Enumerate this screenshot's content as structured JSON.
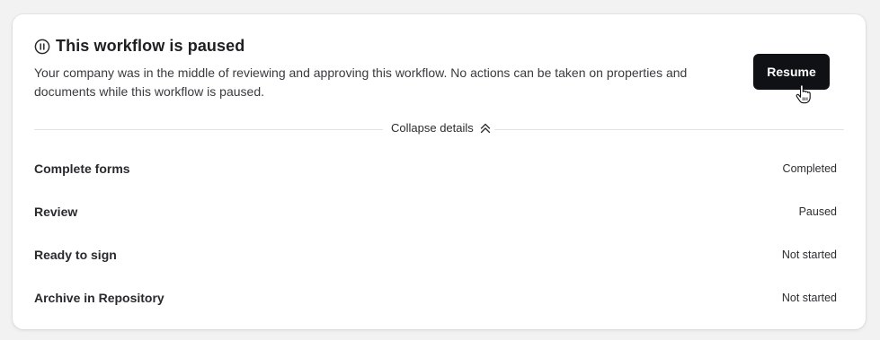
{
  "banner": {
    "title": "This workflow is paused",
    "description": "Your company was in the middle of reviewing and approving this workflow. No actions can be taken on properties and documents while this workflow is paused.",
    "resume_label": "Resume",
    "status_icon": "pause-circle-icon"
  },
  "details": {
    "toggle_label": "Collapse details",
    "toggle_icon": "double-chevron-up-icon"
  },
  "steps": [
    {
      "name": "Complete forms",
      "status": "Completed"
    },
    {
      "name": "Review",
      "status": "Paused"
    },
    {
      "name": "Ready to sign",
      "status": "Not started"
    },
    {
      "name": "Archive in Repository",
      "status": "Not started"
    }
  ],
  "colors": {
    "button_bg": "#101114",
    "button_text": "#ffffff",
    "card_bg": "#ffffff",
    "page_bg": "#f2f2f3",
    "divider": "#e3e3e6"
  }
}
